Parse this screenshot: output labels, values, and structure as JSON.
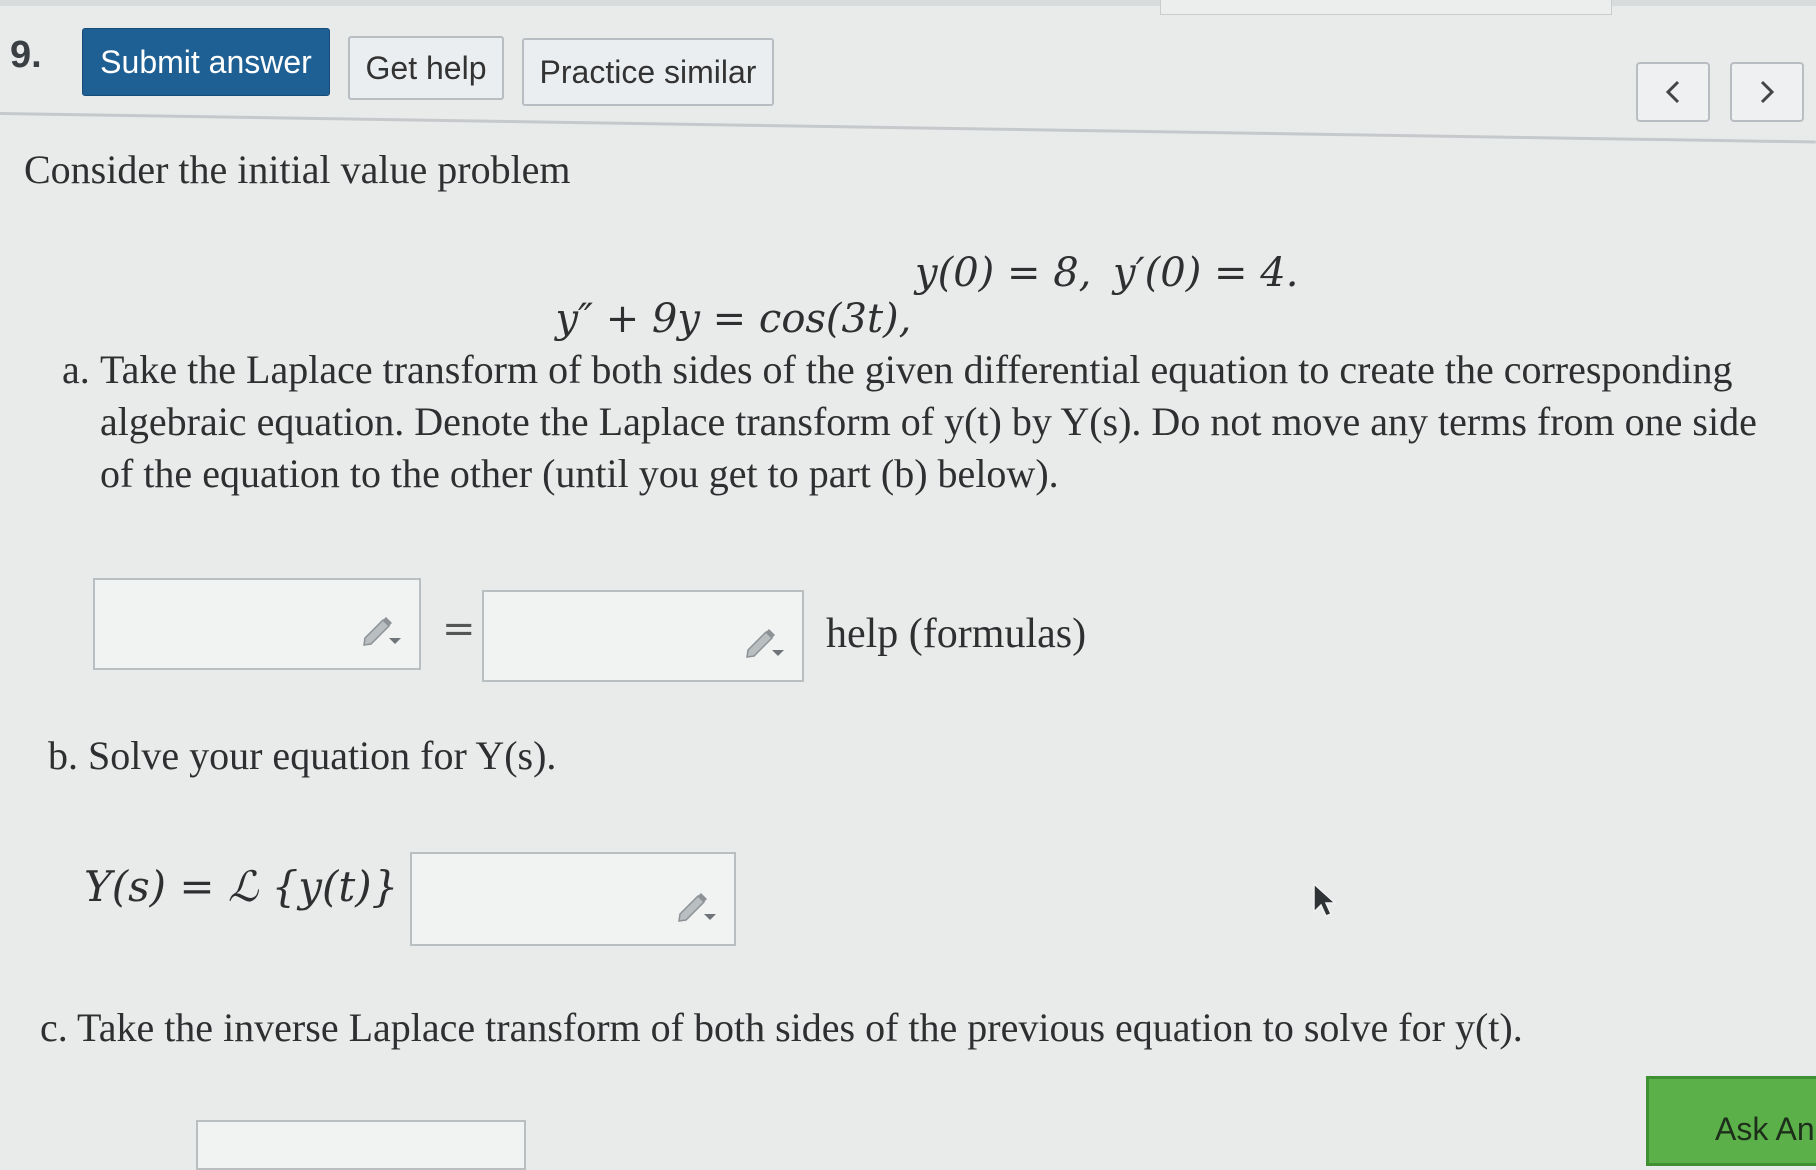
{
  "question": {
    "number": "9."
  },
  "toolbar": {
    "submit_label": "Submit answer",
    "help_label": "Get help",
    "practice_label": "Practice similar"
  },
  "nav": {
    "prev_symbol": "<",
    "next_symbol": ">"
  },
  "problem": {
    "intro": "Consider the initial value problem",
    "equation": "y″ + 9y = cos(3t),",
    "condition1": "y(0) = 8,",
    "condition2": "y′(0) = 4."
  },
  "part_a": {
    "marker": "a.",
    "text": "Take the Laplace transform of both sides of the given differential equation to create the corresponding algebraic equation. Denote the Laplace transform of y(t) by Y(s). Do not move any terms from one side of the equation to the other (until you get to part (b) below).",
    "equals": "=",
    "help_link": "help (formulas)",
    "left_input_value": "",
    "right_input_value": ""
  },
  "part_b": {
    "marker": "b.",
    "text": "Solve your equation for Y(s).",
    "label": "Y(s) = ℒ {y(t)} =",
    "input_value": ""
  },
  "part_c": {
    "marker": "c.",
    "text": "Take the inverse Laplace transform of both sides of the previous equation to solve for y(t)."
  },
  "ask_button": {
    "label": "Ask An"
  },
  "colors": {
    "submit_bg": "#1f6094",
    "ask_bg": "#5bb04a",
    "page_bg": "#e9ebeb"
  },
  "icons": {
    "input_edit": "pencil-icon",
    "pointer": "mouse-cursor-icon"
  }
}
